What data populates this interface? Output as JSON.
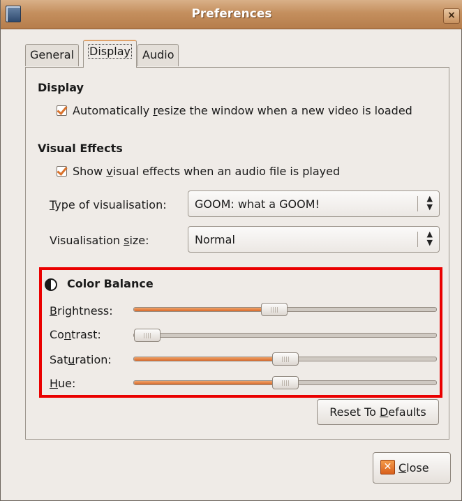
{
  "window": {
    "title": "Preferences",
    "close_glyph": "×"
  },
  "tabs": [
    {
      "label": "General",
      "active": false
    },
    {
      "label": "Display",
      "active": true
    },
    {
      "label": "Audio",
      "active": false
    }
  ],
  "display_section": {
    "title": "Display",
    "auto_resize": {
      "checked": true,
      "pre": "Automatically ",
      "mnemonic": "r",
      "post": "esize the window when a new video is loaded"
    }
  },
  "visual_effects": {
    "title": "Visual Effects",
    "show_effects": {
      "checked": true,
      "pre": "Show ",
      "mnemonic": "v",
      "post": "isual effects when an audio file is played"
    },
    "type": {
      "label_mnemonic": "T",
      "label_rest": "ype of visualisation:",
      "value": "GOOM: what a GOOM!"
    },
    "size": {
      "label_pre": "Visualisation ",
      "label_mnemonic": "s",
      "label_post": "ize:",
      "value": "Normal"
    }
  },
  "color_balance": {
    "title": "Color Balance",
    "icon": "contrast-icon",
    "sliders": [
      {
        "key": "brightness",
        "pre": "",
        "mnemonic": "B",
        "post": "rightness:",
        "value": 0.46
      },
      {
        "key": "contrast",
        "pre": "Co",
        "mnemonic": "n",
        "post": "trast:",
        "value": 0.0
      },
      {
        "key": "saturation",
        "pre": "Sat",
        "mnemonic": "u",
        "post": "ration:",
        "value": 0.5
      },
      {
        "key": "hue",
        "pre": "",
        "mnemonic": "H",
        "post": "ue:",
        "value": 0.5
      }
    ],
    "reset": {
      "pre": "Reset To ",
      "mnemonic": "D",
      "post": "efaults"
    }
  },
  "footer": {
    "close": {
      "mnemonic": "C",
      "post": "lose",
      "icon": "close-icon",
      "icon_glyph": "✕"
    }
  },
  "colors": {
    "accent": "#d9692a",
    "highlight_border": "#ea0000",
    "titlebar": "#c48f5e"
  }
}
